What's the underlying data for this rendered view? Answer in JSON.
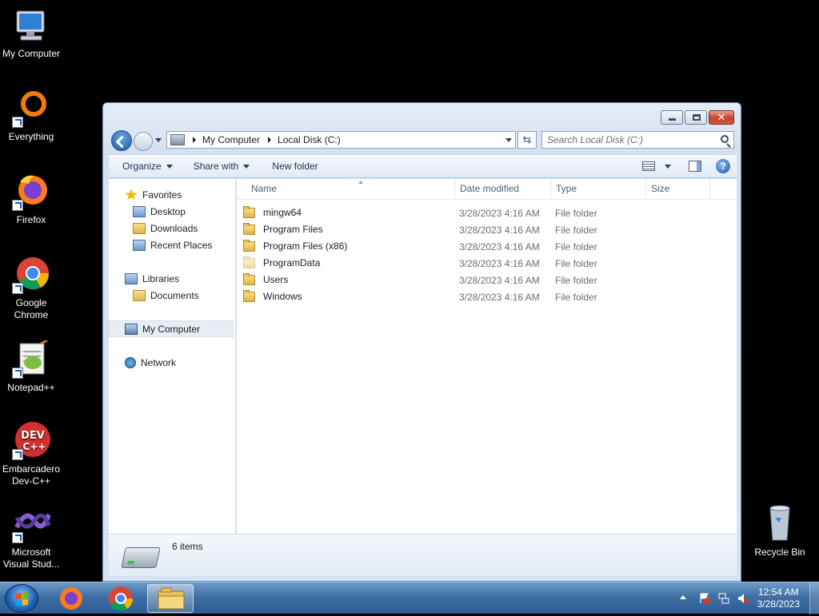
{
  "desktop": {
    "icons": [
      {
        "label": "My Computer"
      },
      {
        "label": "Everything"
      },
      {
        "label": "Firefox"
      },
      {
        "label": "Google Chrome"
      },
      {
        "label": "Notepad++"
      },
      {
        "label": "Embarcadero Dev-C++"
      },
      {
        "label": "Microsoft Visual Stud..."
      },
      {
        "label": "Recycle Bin"
      }
    ]
  },
  "window": {
    "caption_buttons": {
      "minimize": "minimize-icon",
      "maximize": "maximize-icon",
      "close": "✕"
    },
    "breadcrumb": [
      "My Computer",
      "Local Disk (C:)"
    ],
    "search": {
      "placeholder": "Search Local Disk (C:)",
      "value": ""
    },
    "refresh_glyph": "⇆",
    "commands": {
      "organize": "Organize",
      "share_with": "Share with",
      "new_folder": "New folder",
      "help": "?"
    },
    "nav": {
      "favorites": {
        "label": "Favorites",
        "items": [
          "Desktop",
          "Downloads",
          "Recent Places"
        ]
      },
      "libraries": {
        "label": "Libraries",
        "items": [
          "Documents"
        ]
      },
      "computer": {
        "label": "My Computer"
      },
      "network": {
        "label": "Network"
      }
    },
    "columns": {
      "name": "Name",
      "date": "Date modified",
      "type": "Type",
      "size": "Size"
    },
    "files": [
      {
        "name": "mingw64",
        "date": "3/28/2023 4:16 AM",
        "type": "File folder"
      },
      {
        "name": "Program Files",
        "date": "3/28/2023 4:16 AM",
        "type": "File folder"
      },
      {
        "name": "Program Files (x86)",
        "date": "3/28/2023 4:16 AM",
        "type": "File folder"
      },
      {
        "name": "ProgramData",
        "date": "3/28/2023 4:16 AM",
        "type": "File folder"
      },
      {
        "name": "Users",
        "date": "3/28/2023 4:16 AM",
        "type": "File folder"
      },
      {
        "name": "Windows",
        "date": "3/28/2023 4:16 AM",
        "type": "File folder"
      }
    ],
    "details": {
      "item_count": "6 items"
    }
  },
  "taskbar": {
    "clock": {
      "time": "12:54 AM",
      "date": "3/28/2023"
    }
  },
  "colors": {
    "desktop_bg": "#000000",
    "taskbar": "#3f6fa3",
    "accent": "#1f5aa8"
  }
}
